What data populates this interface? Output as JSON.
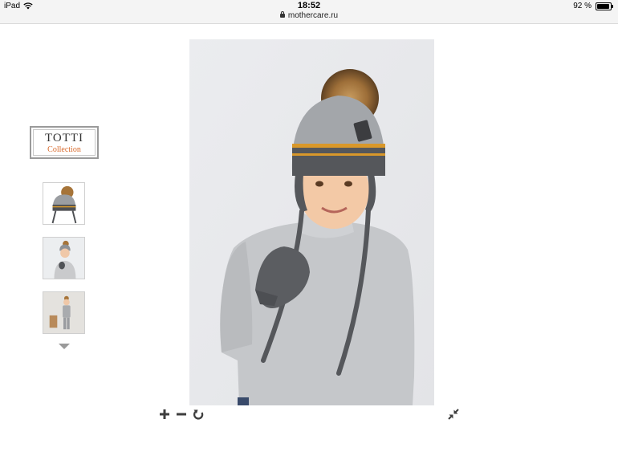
{
  "status_bar": {
    "device": "iPad",
    "time": "18:52",
    "url": "mothercare.ru",
    "battery_text": "92 %",
    "battery_level": 0.92
  },
  "brand": {
    "name": "TOTTI",
    "subtitle": "Collection",
    "accent_color": "#d8692b"
  },
  "gallery": {
    "thumbnails": [
      {
        "icon": "hat-thumbnail-icon"
      },
      {
        "icon": "child-portrait-thumbnail-icon"
      },
      {
        "icon": "child-fullbody-thumbnail-icon"
      }
    ],
    "scroll_down_icon": "triangle-down-icon"
  },
  "viewer": {
    "controls": [
      {
        "icon": "zoom-in-icon"
      },
      {
        "icon": "zoom-out-icon"
      },
      {
        "icon": "reset-rotate-icon"
      },
      {
        "icon": "collapse-fullscreen-icon"
      }
    ]
  }
}
